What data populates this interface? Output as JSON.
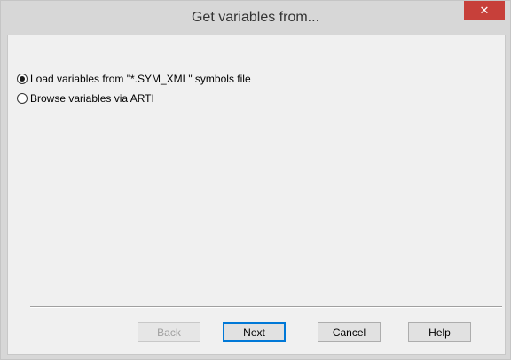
{
  "window": {
    "title": "Get variables from...",
    "close_glyph": "✕",
    "accent_close": "#c7403a"
  },
  "options": [
    {
      "label": "Load variables from \"*.SYM_XML\" symbols file",
      "selected": true
    },
    {
      "label": "Browse variables via ARTI",
      "selected": false
    }
  ],
  "buttons": {
    "back": {
      "label": "Back",
      "enabled": false
    },
    "next": {
      "label": "Next",
      "enabled": true,
      "default": true
    },
    "cancel": {
      "label": "Cancel",
      "enabled": true
    },
    "help": {
      "label": "Help",
      "enabled": true
    }
  }
}
